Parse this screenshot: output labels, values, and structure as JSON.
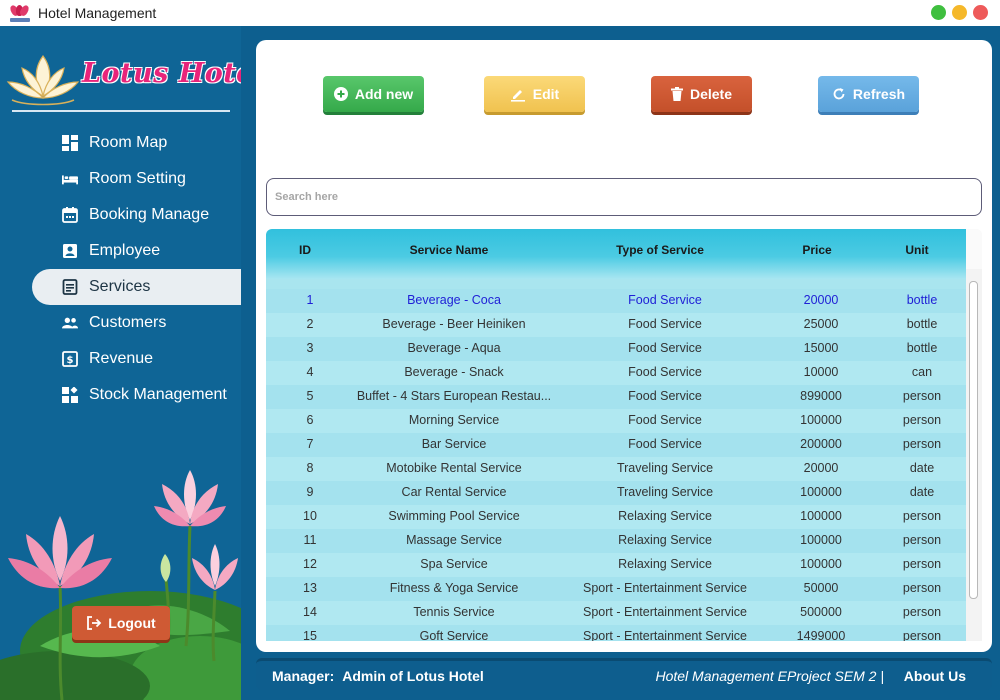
{
  "window": {
    "title": "Hotel Management",
    "controls": [
      {
        "name": "minimize",
        "color": "#3fbf3f"
      },
      {
        "name": "maximize",
        "color": "#f5b82a"
      },
      {
        "name": "close",
        "color": "#ee5a5a"
      }
    ]
  },
  "sidebar": {
    "brand": "Lotus Hotel",
    "items": [
      {
        "label": "Room Map",
        "icon": "dashboard-icon"
      },
      {
        "label": "Room Setting",
        "icon": "bed-icon"
      },
      {
        "label": "Booking Manage",
        "icon": "calendar-icon"
      },
      {
        "label": "Employee",
        "icon": "badge-icon"
      },
      {
        "label": "Services",
        "icon": "document-icon",
        "active": true
      },
      {
        "label": "Customers",
        "icon": "people-icon"
      },
      {
        "label": "Revenue",
        "icon": "money-icon"
      },
      {
        "label": "Stock Management",
        "icon": "widgets-icon"
      }
    ],
    "logout_label": "Logout"
  },
  "toolbar": {
    "add_label": "Add new",
    "edit_label": "Edit",
    "delete_label": "Delete",
    "refresh_label": "Refresh"
  },
  "search": {
    "placeholder": "Search here",
    "value": ""
  },
  "table": {
    "columns": [
      "ID",
      "Service Name",
      "Type of Service",
      "Price",
      "Unit"
    ],
    "selected_row": 0,
    "rows": [
      [
        "1",
        "Beverage - Coca",
        "Food Service",
        "20000",
        "bottle"
      ],
      [
        "2",
        "Beverage - Beer Heiniken",
        "Food Service",
        "25000",
        "bottle"
      ],
      [
        "3",
        "Beverage - Aqua",
        "Food Service",
        "15000",
        "bottle"
      ],
      [
        "4",
        "Beverage - Snack",
        "Food Service",
        "10000",
        "can"
      ],
      [
        "5",
        "Buffet - 4 Stars European Restau...",
        "Food Service",
        "899000",
        "person"
      ],
      [
        "6",
        "Morning Service",
        "Food Service",
        "100000",
        "person"
      ],
      [
        "7",
        "Bar Service",
        "Food Service",
        "200000",
        "person"
      ],
      [
        "8",
        "Motobike Rental Service",
        "Traveling Service",
        "20000",
        "date"
      ],
      [
        "9",
        "Car Rental Service",
        "Traveling Service",
        "100000",
        "date"
      ],
      [
        "10",
        "Swimming Pool Service",
        "Relaxing Service",
        "100000",
        "person"
      ],
      [
        "11",
        "Massage Service",
        "Relaxing Service",
        "100000",
        "person"
      ],
      [
        "12",
        "Spa Service",
        "Relaxing Service",
        "100000",
        "person"
      ],
      [
        "13",
        "Fitness & Yoga Service",
        "Sport - Entertainment Service",
        "50000",
        "person"
      ],
      [
        "14",
        "Tennis Service",
        "Sport - Entertainment Service",
        "500000",
        "person"
      ],
      [
        "15",
        "Goft Service",
        "Sport - Entertainment Service",
        "1499000",
        "person"
      ]
    ]
  },
  "footer": {
    "manager_label": "Manager:",
    "manager_name": "Admin of Lotus Hotel",
    "project": "Hotel Management EProject SEM 2 |",
    "about_label": "About Us"
  },
  "colors": {
    "sidebar_bg": "#0f6596",
    "accent_pink": "#e8247a",
    "add": "#35a94a",
    "edit": "#f0c24f",
    "delete": "#c4502a",
    "refresh": "#5aa2da",
    "selected_text": "#1f1fd6"
  }
}
